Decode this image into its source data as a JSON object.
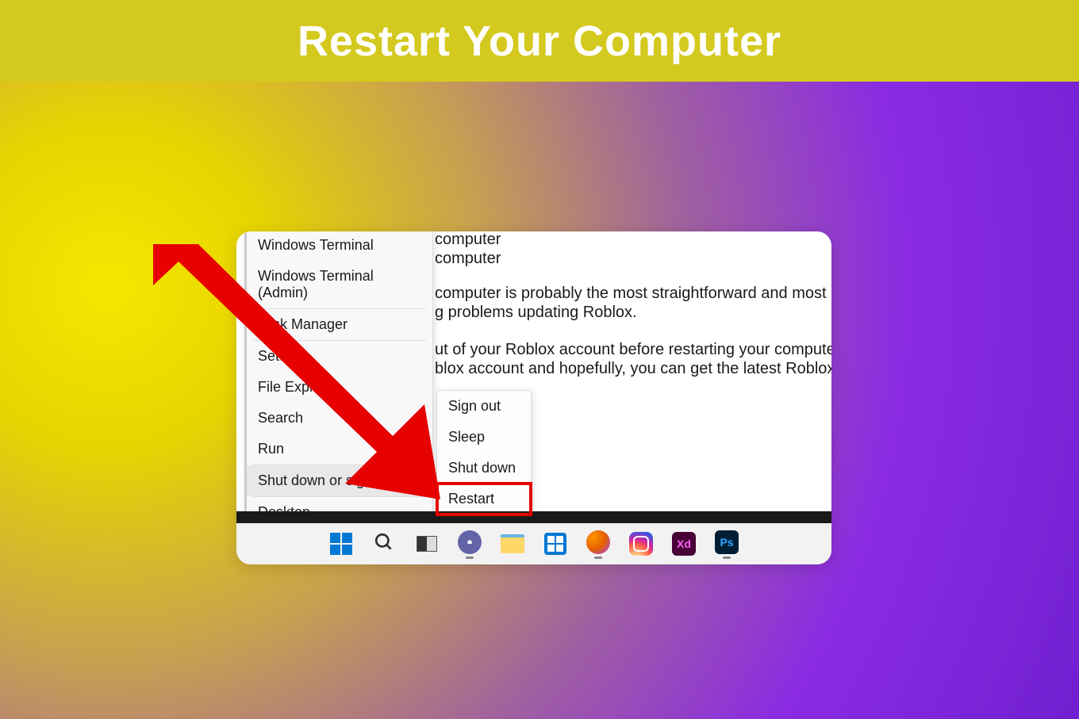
{
  "header": {
    "title": "Restart Your Computer"
  },
  "background_text": {
    "line1": "computer",
    "line2": "computer",
    "para1a": "computer is probably the most straightforward and most comm",
    "para1b": "g problems updating Roblox.",
    "para2a": "ut of your Roblox account before restarting your computer. Onc",
    "para2b": "blox account and hopefully, you can get the latest Roblox versio"
  },
  "context_menu": {
    "items": [
      "Windows Terminal",
      "Windows Terminal (Admin)",
      "Task Manager",
      "Settings",
      "File Explorer",
      "Search",
      "Run",
      "Shut down or sign out",
      "Desktop"
    ],
    "active_index": 7
  },
  "submenu": {
    "items": [
      "Sign out",
      "Sleep",
      "Shut down",
      "Restart"
    ],
    "highlighted_index": 3
  },
  "taskbar": {
    "icons": [
      "start",
      "search",
      "taskview",
      "teams",
      "explorer",
      "store",
      "firefox",
      "instagram",
      "xd",
      "photoshop"
    ],
    "xd_label": "Xd",
    "ps_label": "Ps"
  },
  "colors": {
    "highlight": "#e60000",
    "arrow": "#e60000",
    "header_bg": "#d4c91e"
  }
}
